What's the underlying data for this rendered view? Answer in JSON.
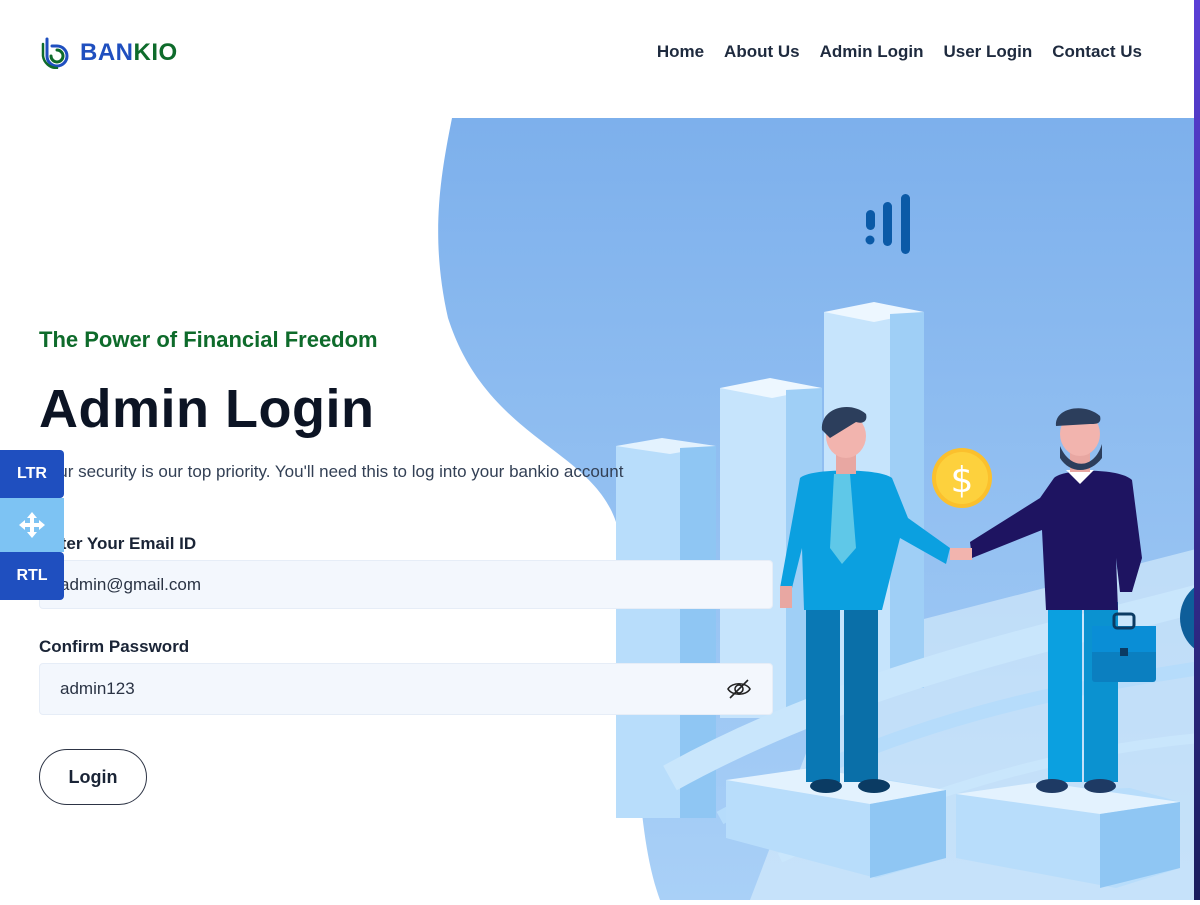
{
  "brand": {
    "part1": "BAN",
    "part2": "KIO",
    "icon": "bankio-logo-icon"
  },
  "nav": {
    "items": [
      {
        "label": "Home"
      },
      {
        "label": "About Us"
      },
      {
        "label": "Admin Login"
      },
      {
        "label": "User Login"
      },
      {
        "label": "Contact Us"
      }
    ]
  },
  "hero": {
    "subtitle": "The Power of Financial Freedom",
    "title": "Admin Login",
    "description": "Your security is our top priority. You'll need this to log into your bankio account"
  },
  "form": {
    "email_label": "Enter Your Email ID",
    "email_value": "admin@gmail.com",
    "password_label": "Confirm Password",
    "password_value": "admin123",
    "password_toggle_icon": "eye-slash-icon",
    "submit_label": "Login"
  },
  "side_tools": {
    "ltr_label": "LTR",
    "move_icon": "move-arrows-icon",
    "rtl_label": "RTL"
  },
  "illustration": {
    "currency_symbol": "$"
  },
  "colors": {
    "brand_blue": "#1f4fbf",
    "brand_green": "#0e6b2b",
    "heading": "#0c1424",
    "hero_blob": "#7fb2ec",
    "input_bg": "#f3f7fd"
  }
}
